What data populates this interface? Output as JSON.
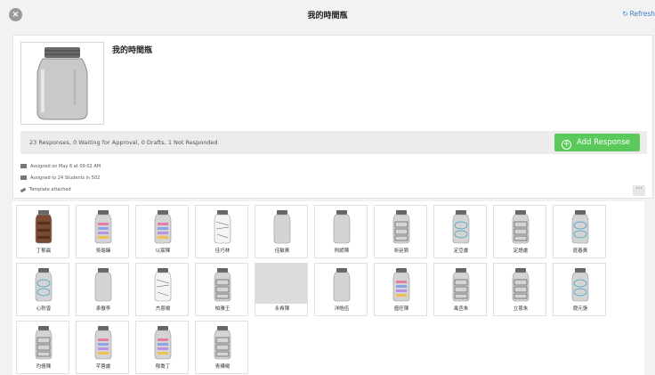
{
  "window": {
    "title": "我的時間瓶",
    "close_icon": "close-icon",
    "refresh_label": "Refresh",
    "refresh_icon": "refresh-icon",
    "accent": "#3b82c4"
  },
  "assignment": {
    "title": "我的時間瓶",
    "stats": "23 Responses, 0 Waiting for Approval, 0 Drafts, 1 Not Responded",
    "add_response_label": "Add Response",
    "add_button_color": "#5cc95c",
    "meta": [
      {
        "icon": "calendar-icon",
        "text": "Assigned on May 6 at 09:02 AM"
      },
      {
        "icon": "students-icon",
        "text": "Assigned to 24 Students in 502"
      },
      {
        "icon": "paperclip-icon",
        "text": "Template attached"
      }
    ],
    "more_label": "···"
  },
  "responses": [
    {
      "name": "丁郁晨",
      "style": "brown"
    },
    {
      "name": "吳瑜臻",
      "style": "labels"
    },
    {
      "name": "以宸陳",
      "style": "labels"
    },
    {
      "name": "佳巧林",
      "style": "sketch"
    },
    {
      "name": "佳敏黃",
      "style": "plain"
    },
    {
      "name": "則諺陳",
      "style": "plain"
    },
    {
      "name": "祈廷劉",
      "style": "boxes"
    },
    {
      "name": "定亞盧",
      "style": "blue"
    },
    {
      "name": "定語盧",
      "style": "boxes"
    },
    {
      "name": "庭春黃",
      "style": "blue"
    },
    {
      "name": "心聆曾",
      "style": "blue"
    },
    {
      "name": "承傲李",
      "style": "plain"
    },
    {
      "name": "杰恩楊",
      "style": "sketch"
    },
    {
      "name": "柏雅王",
      "style": "boxes"
    },
    {
      "name": "永希陳",
      "style": "blank"
    },
    {
      "name": "洋皓伍",
      "style": "plain"
    },
    {
      "name": "盛旺陳",
      "style": "labels"
    },
    {
      "name": "禹丞朱",
      "style": "boxes"
    },
    {
      "name": "立恩朱",
      "style": "boxes"
    },
    {
      "name": "競元張",
      "style": "blue"
    },
    {
      "name": "玓倩陳",
      "style": "boxes"
    },
    {
      "name": "芊蓉盧",
      "style": "labels"
    },
    {
      "name": "郁喬丁",
      "style": "labels"
    },
    {
      "name": "青樺楊",
      "style": "boxes"
    }
  ]
}
